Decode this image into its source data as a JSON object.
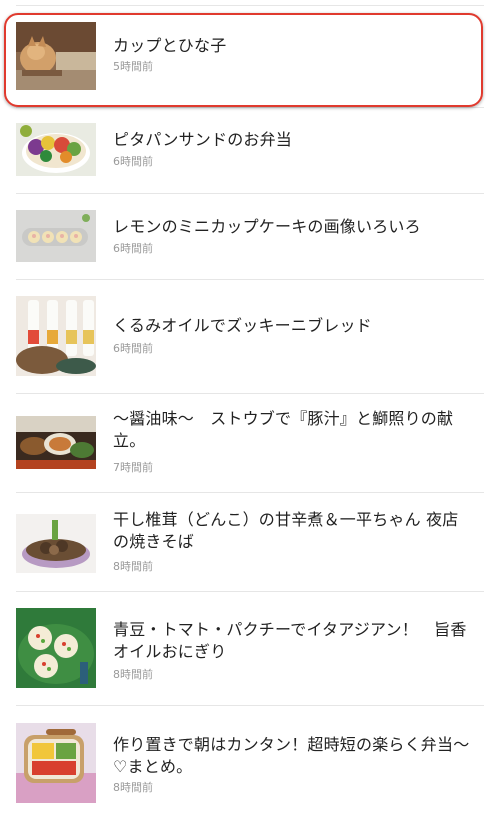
{
  "feed": {
    "items": [
      {
        "title": "カップとひな子",
        "time": "5時間前",
        "thumb": "cat-photo"
      },
      {
        "title": "ピタパンサンドのお弁当",
        "time": "6時間前",
        "thumb": "bento-photo"
      },
      {
        "title": "レモンのミニカップケーキの画像いろいろ",
        "time": "6時間前",
        "thumb": "cupcake-photo"
      },
      {
        "title": "くるみオイルでズッキーニブレッド",
        "time": "6時間前",
        "thumb": "bottles-bread-photo"
      },
      {
        "title": "〜醤油味〜　ストウブで『豚汁』と鰤照りの献立。",
        "time": "7時間前",
        "thumb": "japanese-meal-photo"
      },
      {
        "title": "干し椎茸（どんこ）の甘辛煮＆一平ちゃん 夜店の焼きそば",
        "time": "8時間前",
        "thumb": "noodle-bowl-photo"
      },
      {
        "title": "青豆・トマト・パクチーでイタアジアン！　旨香オイルおにぎり",
        "time": "8時間前",
        "thumb": "onigiri-photo"
      },
      {
        "title": "作り置きで朝はカンタン！超時短の楽らく弁当〜♡まとめ。",
        "time": "8時間前",
        "thumb": "lunchbox-photo"
      }
    ]
  },
  "colors": {
    "highlight": "#e03a2e",
    "divider": "#e6e6e6",
    "time_text": "#9a9a9a"
  }
}
